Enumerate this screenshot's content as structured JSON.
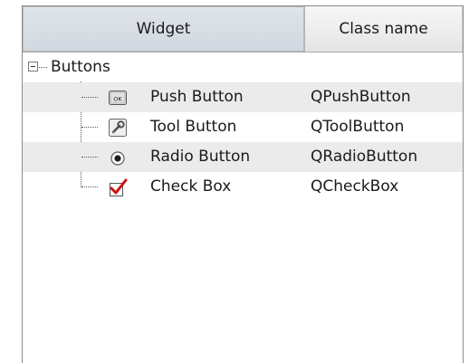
{
  "header": {
    "widget_label": "Widget",
    "classname_label": "Class name"
  },
  "tree": {
    "group": {
      "label": "Buttons",
      "expanded": true
    },
    "items": [
      {
        "label": "Push Button",
        "class_name": "QPushButton",
        "icon": "push-button-icon"
      },
      {
        "label": "Tool Button",
        "class_name": "QToolButton",
        "icon": "tool-button-icon"
      },
      {
        "label": "Radio Button",
        "class_name": "QRadioButton",
        "icon": "radio-button-icon"
      },
      {
        "label": "Check Box",
        "class_name": "QCheckBox",
        "icon": "check-box-icon"
      }
    ]
  },
  "colors": {
    "alt_row": "#ebebeb",
    "check_mark": "#cc1111"
  }
}
